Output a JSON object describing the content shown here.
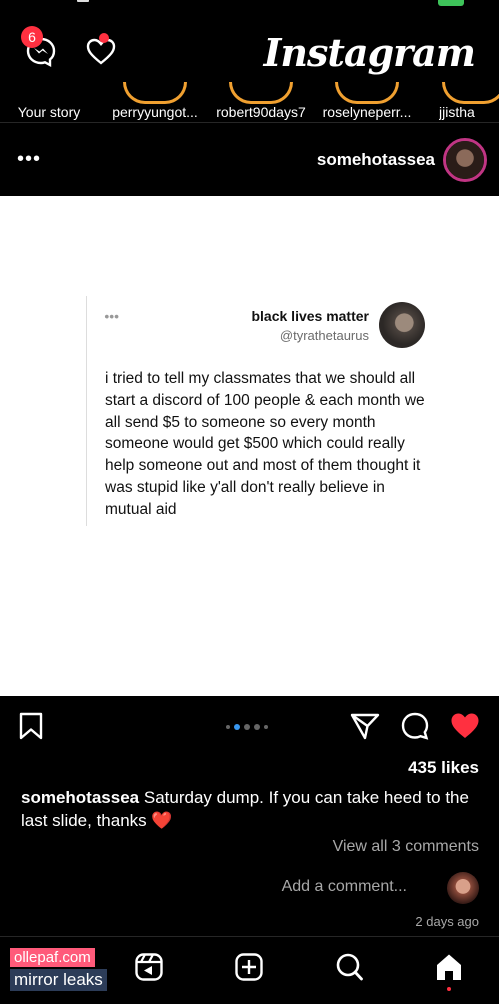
{
  "app": {
    "title": "Instagram",
    "message_badge_count": "6"
  },
  "stories": [
    {
      "name": "Your story"
    },
    {
      "name": "perryyungot..."
    },
    {
      "name": "robert90days7"
    },
    {
      "name": "roselyneperr..."
    },
    {
      "name": "jjistha"
    }
  ],
  "post": {
    "username": "somehotassea",
    "tweet": {
      "name": "black lives matter",
      "handle": "@tyrathetaurus",
      "text": "i tried to tell my classmates that we should all start a discord of 100 people & each month we all send $5 to someone so every month someone would get $500 which could really help someone out and most of them thought it was stupid like y'all don't really believe in mutual aid"
    },
    "likes": "435 likes",
    "caption_user": "somehotassea",
    "caption_text": "Saturday dump. If you can take heed to the last slide, thanks ❤️",
    "view_comments": "View all 3 comments",
    "add_comment_placeholder": "Add a comment...",
    "timestamp": "2 days ago",
    "carousel": {
      "count": 5,
      "active": 2
    }
  },
  "watermark": {
    "line1": "ollepaf.com",
    "line2": "mirror leaks"
  },
  "colors": {
    "accent": "#ff3040",
    "link": "#3897f0",
    "background": "#000000"
  },
  "icons": [
    "messenger-icon",
    "heart-icon",
    "more-icon",
    "like-icon",
    "comment-icon",
    "share-icon",
    "save-icon",
    "home-icon",
    "search-icon",
    "add-post-icon",
    "reels-icon"
  ]
}
